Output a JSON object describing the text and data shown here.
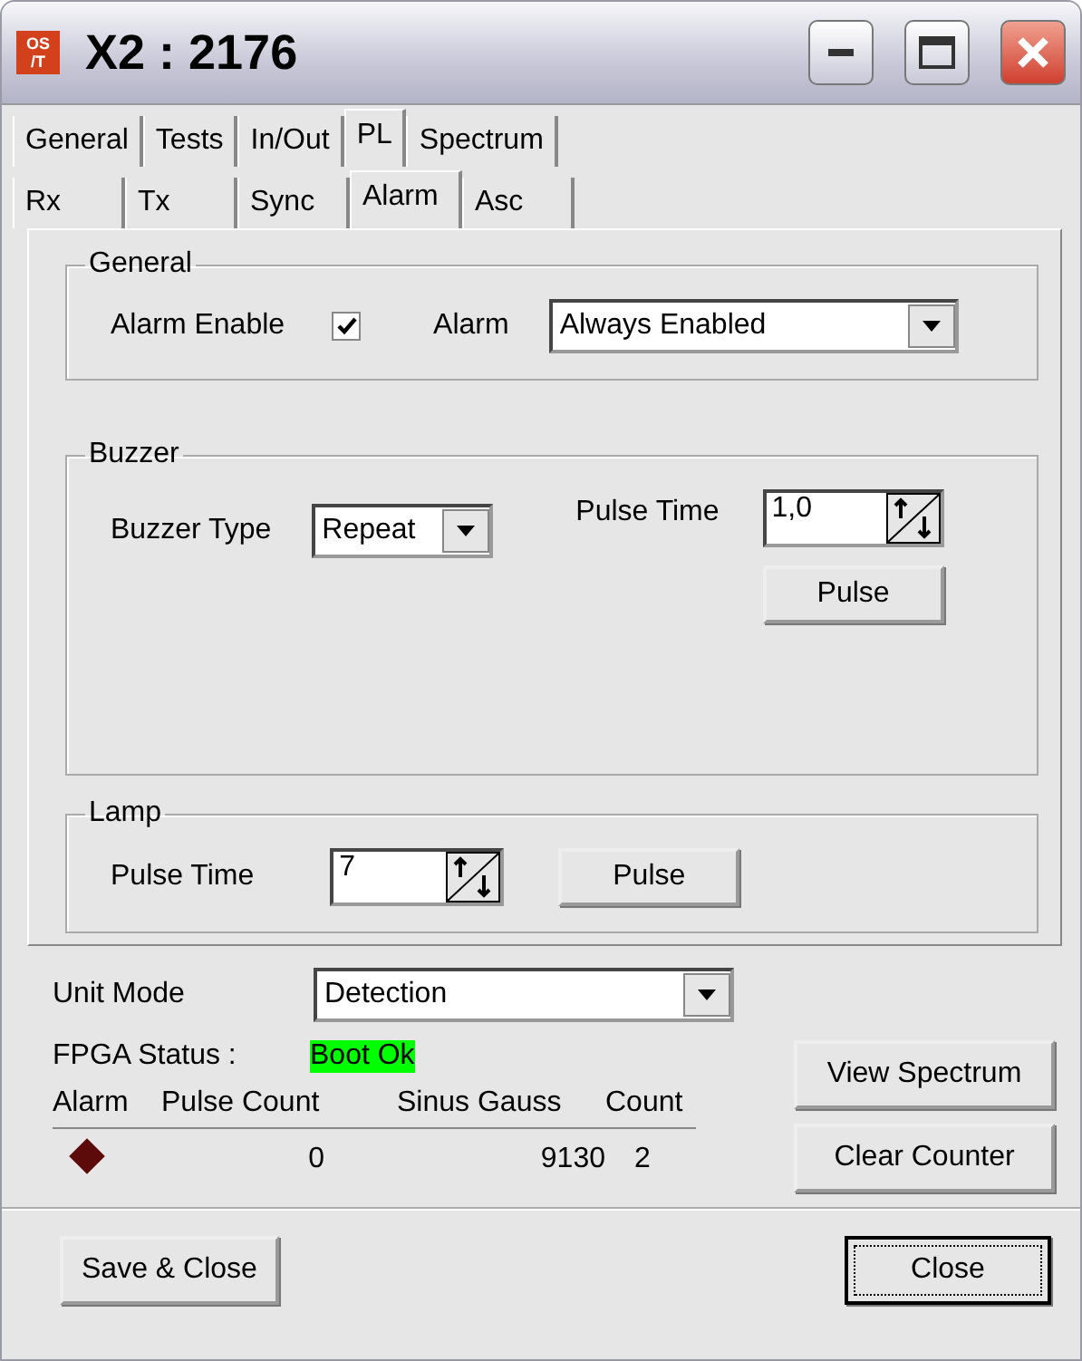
{
  "window": {
    "icon_text": "OS\n/T",
    "title": "X2 : 2176"
  },
  "tabs": [
    {
      "label": "General",
      "selected": false
    },
    {
      "label": "Tests",
      "selected": false
    },
    {
      "label": "In/Out",
      "selected": false
    },
    {
      "label": "PL",
      "selected": true
    },
    {
      "label": "Spectrum",
      "selected": false
    }
  ],
  "subtabs": [
    {
      "label": "Rx",
      "selected": false
    },
    {
      "label": "Tx",
      "selected": false
    },
    {
      "label": "Sync",
      "selected": false
    },
    {
      "label": "Alarm",
      "selected": true
    },
    {
      "label": "Asc",
      "selected": false
    }
  ],
  "general_group": {
    "title": "General",
    "alarm_enable_label": "Alarm Enable",
    "alarm_enable_checked": true,
    "alarm_label": "Alarm",
    "alarm_value": "Always Enabled"
  },
  "buzzer_group": {
    "title": "Buzzer",
    "type_label": "Buzzer Type",
    "type_value": "Repeat",
    "pulse_time_label": "Pulse Time",
    "pulse_time_value": "1,0",
    "pulse_button": "Pulse"
  },
  "lamp_group": {
    "title": "Lamp",
    "pulse_time_label": "Pulse Time",
    "pulse_time_value": "7",
    "pulse_button": "Pulse"
  },
  "unit_mode": {
    "label": "Unit Mode",
    "value": "Detection"
  },
  "fpga_status": {
    "label": "FPGA Status :",
    "value": "Boot Ok",
    "color": "#00ff00"
  },
  "counters": {
    "columns": [
      "Alarm",
      "Pulse Count",
      "Sinus Gauss",
      "Count"
    ],
    "row": {
      "alarm": {
        "color": "#5c0a0a"
      },
      "pulse_count": "0",
      "sinus_gauss": "9130",
      "count": "2"
    }
  },
  "side_buttons": [
    "View Spectrum",
    "Clear Counter"
  ],
  "footer_buttons": [
    {
      "label": "Save & Close",
      "default": false
    },
    {
      "label": "Close",
      "default": true
    }
  ]
}
